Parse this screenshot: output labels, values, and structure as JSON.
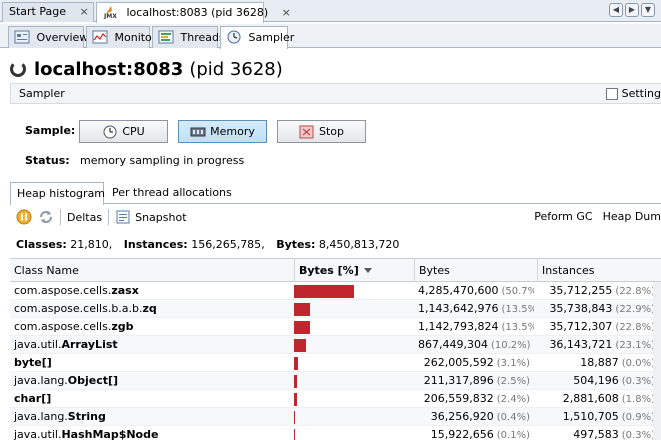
{
  "doc_tabs": [
    {
      "label": "Start Page"
    },
    {
      "label": "localhost:8083 (pid 3628)",
      "close": "×"
    }
  ],
  "doc_tab_close_first": "×",
  "view_tabs": [
    {
      "label": "Overview",
      "icon": "overview-icon"
    },
    {
      "label": "Monitor",
      "icon": "monitor-icon"
    },
    {
      "label": "Threads",
      "icon": "threads-icon"
    },
    {
      "label": "Sampler",
      "icon": "sampler-icon"
    }
  ],
  "title": {
    "host": "localhost:8083",
    "pid": "(pid 3628)"
  },
  "sampler_bar": {
    "label": "Sampler",
    "settings_label": "Setting"
  },
  "sample": {
    "label": "Sample:",
    "buttons": [
      {
        "label": "CPU",
        "icon": "clock-icon"
      },
      {
        "label": "Memory",
        "icon": "memory-icon"
      },
      {
        "label": "Stop",
        "icon": "stop-icon"
      }
    ],
    "status_label": "Status:",
    "status_text": "memory sampling in progress"
  },
  "inner_tabs": [
    {
      "label": "Heap histogram"
    },
    {
      "label": "Per thread allocations"
    }
  ],
  "toolbar": {
    "deltas": "Deltas",
    "snapshot": "Snapshot",
    "perform_gc": "Peform GC",
    "heap_dump": "Heap Dum"
  },
  "summary": {
    "classes_label": "Classes:",
    "classes_value": "21,810",
    "instances_label": "Instances:",
    "instances_value": "156,265,785",
    "bytes_label": "Bytes:",
    "bytes_value": "8,450,813,720"
  },
  "table": {
    "columns": {
      "name": "Class Name",
      "bytes_pct": "Bytes [%]",
      "bytes": "Bytes",
      "instances": "Instances"
    },
    "rows": [
      {
        "pkg": "com.aspose.cells.",
        "cls": "zasx",
        "bytes": "4,285,470,600",
        "bytes_pct": "(50.7%)",
        "inst": "35,712,255",
        "inst_pct": "(22.8%)",
        "bar": 0.507
      },
      {
        "pkg": "com.aspose.cells.b.a.b.",
        "cls": "zq",
        "bytes": "1,143,642,976",
        "bytes_pct": "(13.5%)",
        "inst": "35,738,843",
        "inst_pct": "(22.9%)",
        "bar": 0.135
      },
      {
        "pkg": "com.aspose.cells.",
        "cls": "zgb",
        "bytes": "1,142,793,824",
        "bytes_pct": "(13.5%)",
        "inst": "35,712,307",
        "inst_pct": "(22.8%)",
        "bar": 0.135
      },
      {
        "pkg": "java.util.",
        "cls": "ArrayList",
        "bytes": "867,449,304",
        "bytes_pct": "(10.2%)",
        "inst": "36,143,721",
        "inst_pct": "(23.1%)",
        "bar": 0.102
      },
      {
        "pkg": "",
        "cls": "byte[]",
        "bytes": "262,005,592",
        "bytes_pct": "(3.1%)",
        "inst": "18,887",
        "inst_pct": "(0.0%)",
        "bar": 0.031
      },
      {
        "pkg": "java.lang.",
        "cls": "Object[]",
        "bytes": "211,317,896",
        "bytes_pct": "(2.5%)",
        "inst": "504,196",
        "inst_pct": "(0.3%)",
        "bar": 0.025
      },
      {
        "pkg": "",
        "cls": "char[]",
        "bytes": "206,559,832",
        "bytes_pct": "(2.4%)",
        "inst": "2,881,608",
        "inst_pct": "(1.8%)",
        "bar": 0.024
      },
      {
        "pkg": "java.lang.",
        "cls": "String",
        "bytes": "36,256,920",
        "bytes_pct": "(0.4%)",
        "inst": "1,510,705",
        "inst_pct": "(0.9%)",
        "bar": 0.004
      },
      {
        "pkg": "java.util.",
        "cls": "HashMap$Node",
        "bytes": "15,922,656",
        "bytes_pct": "(0.1%)",
        "inst": "497,583",
        "inst_pct": "(0.3%)",
        "bar": 0.001
      }
    ]
  },
  "colors": {
    "bar": "#c0262d",
    "active_button": "#bfe0f7"
  }
}
